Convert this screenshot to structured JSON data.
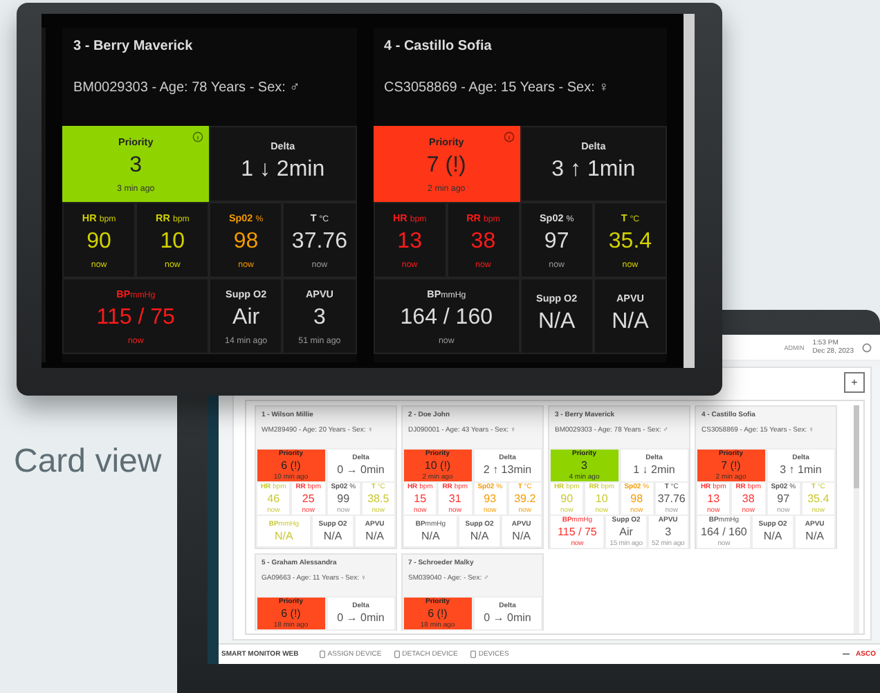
{
  "front_screen": {
    "cards": [
      {
        "title": "3 - Berry Maverick",
        "subtitle": "BM0029303 - Age: 78 Years - Sex: ♂",
        "priority": {
          "label": "Priority",
          "value": "3",
          "time": "3 min ago",
          "color": "#8fd400"
        },
        "delta": {
          "label": "Delta",
          "value": "1 ↓ 2min"
        },
        "vitals": [
          {
            "label": "HR",
            "unit": "bpm",
            "value": "90",
            "time": "now",
            "color": "#d2d200"
          },
          {
            "label": "RR",
            "unit": "bpm",
            "value": "10",
            "time": "now",
            "color": "#d2d200"
          },
          {
            "label": "Sp02",
            "unit": "%",
            "value": "98",
            "time": "now",
            "color": "#f59a00"
          },
          {
            "label": "T",
            "unit": "°C",
            "value": "37.76",
            "time": "now"
          }
        ],
        "bottom": [
          {
            "label": "BP",
            "unit": "mmHg",
            "value": "115 / 75",
            "time": "now",
            "color": "#ff1a1a"
          },
          {
            "label": "Supp O2",
            "value": "Air",
            "time": "14 min ago"
          },
          {
            "label": "APVU",
            "value": "3",
            "time": "51 min ago"
          }
        ]
      },
      {
        "title": "4 - Castillo Sofia",
        "subtitle": "CS3058869 - Age: 15 Years - Sex: ♀",
        "priority": {
          "label": "Priority",
          "value": "7 (!)",
          "time": "2 min ago",
          "color": "#ff3517"
        },
        "delta": {
          "label": "Delta",
          "value": "3 ↑ 1min"
        },
        "vitals": [
          {
            "label": "HR",
            "unit": "bpm",
            "value": "13",
            "time": "now",
            "color": "#ff1a1a"
          },
          {
            "label": "RR",
            "unit": "bpm",
            "value": "38",
            "time": "now",
            "color": "#ff1a1a"
          },
          {
            "label": "Sp02",
            "unit": "%",
            "value": "97",
            "time": "now"
          },
          {
            "label": "T",
            "unit": "°C",
            "value": "35.4",
            "time": "now",
            "color": "#d2d200"
          }
        ],
        "bottom": [
          {
            "label": "BP",
            "unit": "mmHg",
            "value": "164 / 160",
            "time": "now"
          },
          {
            "label": "Supp O2",
            "value": "N/A"
          },
          {
            "label": "APVU",
            "value": "N/A"
          }
        ]
      }
    ]
  },
  "caption": "Card view",
  "back_screen": {
    "header": {
      "user": "ADMIN",
      "time": "1:53 PM",
      "date": "Dec 28, 2023"
    },
    "add_button": "+",
    "cards": [
      {
        "title": "1 - Wilson Millie",
        "subtitle": "WM289490 - Age: 20 Years - Sex: ♀",
        "priority": {
          "label": "Priority",
          "value": "6 (!)",
          "time": "10 min ago",
          "color": "#ff4a1f"
        },
        "delta": {
          "label": "Delta",
          "value": "0 → 0min"
        },
        "vitals": [
          {
            "label": "HR",
            "unit": "bpm",
            "value": "46",
            "time": "now",
            "color": "#c8c830"
          },
          {
            "label": "RR",
            "unit": "bpm",
            "value": "25",
            "time": "now",
            "color": "#ff3030"
          },
          {
            "label": "Sp02",
            "unit": "%",
            "value": "99",
            "time": "now"
          },
          {
            "label": "T",
            "unit": "°C",
            "value": "38.5",
            "time": "now",
            "color": "#c8c830"
          }
        ],
        "bottom": [
          {
            "label": "BP",
            "unit": "mmHg",
            "value": "N/A",
            "color": "#c8c830"
          },
          {
            "label": "Supp O2",
            "value": "N/A"
          },
          {
            "label": "APVU",
            "value": "N/A"
          }
        ]
      },
      {
        "title": "2 - Doe John",
        "subtitle": "DJ090001 - Age: 43 Years - Sex: ♀",
        "priority": {
          "label": "Priority",
          "value": "10 (!)",
          "time": "2 min ago",
          "color": "#ff4a1f"
        },
        "delta": {
          "label": "Delta",
          "value": "2 ↑ 13min"
        },
        "vitals": [
          {
            "label": "HR",
            "unit": "bpm",
            "value": "15",
            "time": "now",
            "color": "#ff3030"
          },
          {
            "label": "RR",
            "unit": "bpm",
            "value": "31",
            "time": "now",
            "color": "#ff3030"
          },
          {
            "label": "Sp02",
            "unit": "%",
            "value": "93",
            "time": "now",
            "color": "#f59a00"
          },
          {
            "label": "T",
            "unit": "°C",
            "value": "39.2",
            "time": "now",
            "color": "#f59a00"
          }
        ],
        "bottom": [
          {
            "label": "BP",
            "unit": "mmHg",
            "value": "N/A"
          },
          {
            "label": "Supp O2",
            "value": "N/A"
          },
          {
            "label": "APVU",
            "value": "N/A"
          }
        ]
      },
      {
        "title": "3 - Berry Maverick",
        "subtitle": "BM0029303 - Age: 78 Years - Sex: ♂",
        "priority": {
          "label": "Priority",
          "value": "3",
          "time": "4 min ago",
          "color": "#8fd400"
        },
        "delta": {
          "label": "Delta",
          "value": "1 ↓ 2min"
        },
        "vitals": [
          {
            "label": "HR",
            "unit": "bpm",
            "value": "90",
            "time": "now",
            "color": "#c8c830"
          },
          {
            "label": "RR",
            "unit": "bpm",
            "value": "10",
            "time": "now",
            "color": "#c8c830"
          },
          {
            "label": "Sp02",
            "unit": "%",
            "value": "98",
            "time": "now",
            "color": "#f59a00"
          },
          {
            "label": "T",
            "unit": "°C",
            "value": "37.76",
            "time": "now"
          }
        ],
        "bottom": [
          {
            "label": "BP",
            "unit": "mmHg",
            "value": "115 / 75",
            "time": "now",
            "color": "#ff3030"
          },
          {
            "label": "Supp O2",
            "value": "Air",
            "time": "15 min ago"
          },
          {
            "label": "APVU",
            "value": "3",
            "time": "52 min ago"
          }
        ]
      },
      {
        "title": "4 - Castillo Sofia",
        "subtitle": "CS3058869 - Age: 15 Years - Sex: ♀",
        "priority": {
          "label": "Priority",
          "value": "7 (!)",
          "time": "2 min ago",
          "color": "#ff4a1f"
        },
        "delta": {
          "label": "Delta",
          "value": "3 ↑ 1min"
        },
        "vitals": [
          {
            "label": "HR",
            "unit": "bpm",
            "value": "13",
            "time": "now",
            "color": "#ff3030"
          },
          {
            "label": "RR",
            "unit": "bpm",
            "value": "38",
            "time": "now",
            "color": "#ff3030"
          },
          {
            "label": "Sp02",
            "unit": "%",
            "value": "97",
            "time": "now"
          },
          {
            "label": "T",
            "unit": "°C",
            "value": "35.4",
            "time": "now",
            "color": "#c8c830"
          }
        ],
        "bottom": [
          {
            "label": "BP",
            "unit": "mmHg",
            "value": "164 / 160",
            "time": "now"
          },
          {
            "label": "Supp O2",
            "value": "N/A"
          },
          {
            "label": "APVU",
            "value": "N/A"
          }
        ]
      },
      {
        "title": "5 - Graham Alessandra",
        "subtitle": "GA09663 - Age: 11 Years - Sex: ♀",
        "priority": {
          "label": "Priority",
          "value": "6 (!)",
          "time": "18 min ago",
          "color": "#ff4a1f"
        },
        "delta": {
          "label": "Delta",
          "value": "0 → 0min"
        }
      },
      {
        "title": "7 - Schroeder Malky",
        "subtitle": "SM039040 - Age: - Sex: ♂",
        "priority": {
          "label": "Priority",
          "value": "6 (!)",
          "time": "18 min ago",
          "color": "#ff4a1f"
        },
        "delta": {
          "label": "Delta",
          "value": "0 → 0min"
        }
      }
    ],
    "footer": {
      "app_name": "SMART MONITOR WEB",
      "actions": [
        "ASSIGN DEVICE",
        "DETACH DEVICE",
        "DEVICES"
      ],
      "brand": "ASCO"
    }
  }
}
